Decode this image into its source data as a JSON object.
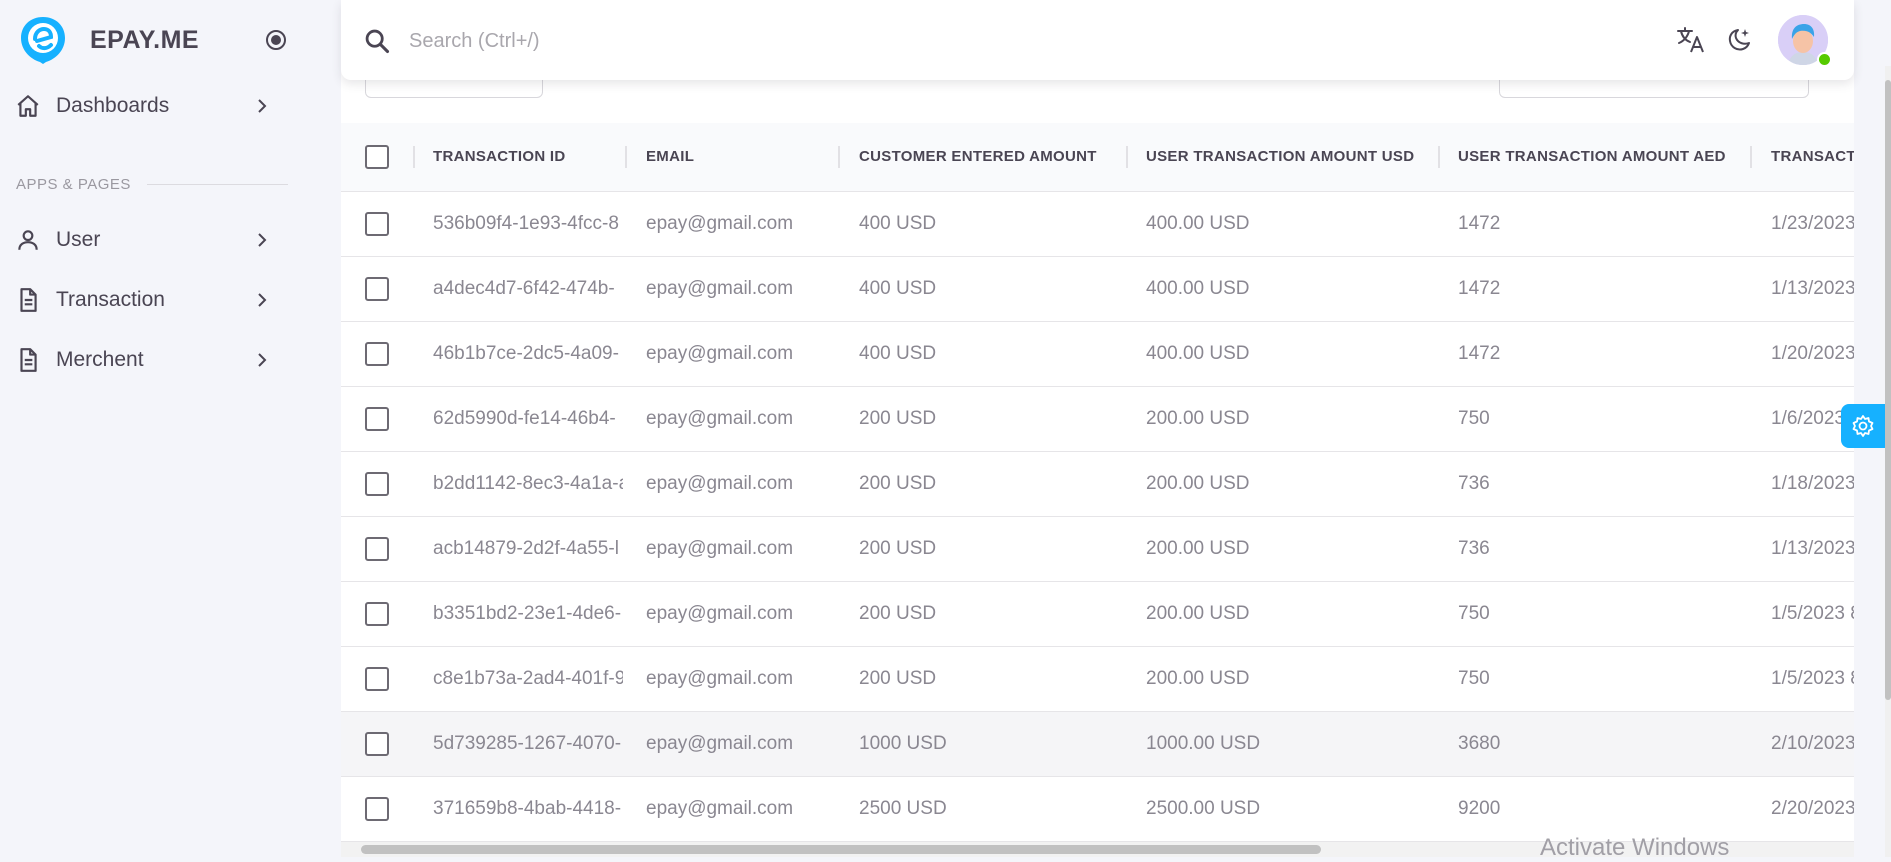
{
  "brand": {
    "name": "EPAY.ME",
    "accent": "#16b1ff"
  },
  "sidebar": {
    "items": [
      {
        "label": "Dashboards",
        "icon": "home-icon"
      }
    ],
    "section_title": "APPS & PAGES",
    "section_items": [
      {
        "label": "User",
        "icon": "user-icon"
      },
      {
        "label": "Transaction",
        "icon": "file-icon"
      },
      {
        "label": "Merchent",
        "icon": "file-icon"
      }
    ]
  },
  "search": {
    "placeholder": "Search (Ctrl+/)"
  },
  "header_icons": [
    "translate-icon",
    "moon-icon",
    "avatar"
  ],
  "table": {
    "columns": [
      "TRANSACTION ID",
      "EMAIL",
      "CUSTOMER ENTERED AMOUNT",
      "USER TRANSACTION AMOUNT USD",
      "USER TRANSACTION AMOUNT AED",
      "TRANSACT"
    ],
    "rows": [
      [
        "536b09f4-1e93-4fcc-8",
        "epay@gmail.com",
        "400 USD",
        "400.00 USD",
        "1472",
        "1/23/2023"
      ],
      [
        "a4dec4d7-6f42-474b-",
        "epay@gmail.com",
        "400 USD",
        "400.00 USD",
        "1472",
        "1/13/2023"
      ],
      [
        "46b1b7ce-2dc5-4a09-",
        "epay@gmail.com",
        "400 USD",
        "400.00 USD",
        "1472",
        "1/20/2023"
      ],
      [
        "62d5990d-fe14-46b4-",
        "epay@gmail.com",
        "200 USD",
        "200.00 USD",
        "750",
        "1/6/2023"
      ],
      [
        "b2dd1142-8ec3-4a1a-a",
        "epay@gmail.com",
        "200 USD",
        "200.00 USD",
        "736",
        "1/18/2023"
      ],
      [
        "acb14879-2d2f-4a55-l",
        "epay@gmail.com",
        "200 USD",
        "200.00 USD",
        "736",
        "1/13/2023"
      ],
      [
        "b3351bd2-23e1-4de6-",
        "epay@gmail.com",
        "200 USD",
        "200.00 USD",
        "750",
        "1/5/2023 8"
      ],
      [
        "c8e1b73a-2ad4-401f-9",
        "epay@gmail.com",
        "200 USD",
        "200.00 USD",
        "750",
        "1/5/2023 8"
      ],
      [
        "5d739285-1267-4070-",
        "epay@gmail.com",
        "1000 USD",
        "1000.00 USD",
        "3680",
        "2/10/2023"
      ],
      [
        "371659b8-4bab-4418-",
        "epay@gmail.com",
        "2500 USD",
        "2500.00 USD",
        "9200",
        "2/20/2023"
      ]
    ]
  },
  "watermark": "Activate Windows"
}
